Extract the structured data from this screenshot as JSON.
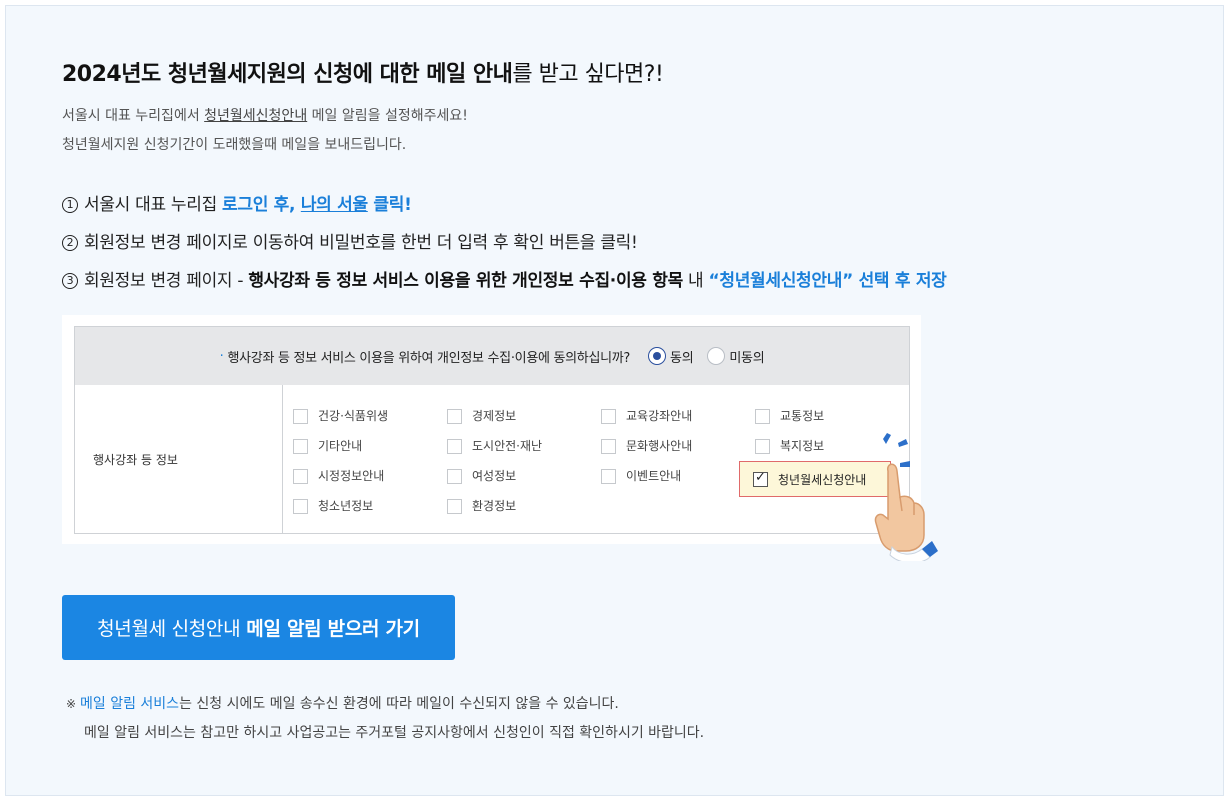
{
  "title": {
    "bold": "2024년도 청년월세지원의 신청에 대한 메일 안내",
    "light": "를 받고 싶다면?!"
  },
  "desc": {
    "line1_before": "서울시 대표 누리집에서 ",
    "line1_link": "청년월세신청안내",
    "line1_after": " 메일 알림을 설정해주세요!",
    "line2": "청년월세지원 신청기간이 도래했을때 메일을 보내드립니다."
  },
  "steps": [
    {
      "num": "1",
      "text": "서울시 대표 누리집 ",
      "blue1": "로그인 후, ",
      "blue_link": "나의 서울",
      "blue2": " 클릭!"
    },
    {
      "num": "2",
      "text": "회원정보 변경 페이지로 이동하여 비밀번호를 한번 더 입력 후 확인 버튼을 클릭!"
    },
    {
      "num": "3",
      "text": "회원정보 변경 페이지 - ",
      "bold": "행사강좌 등 정보 서비스 이용을 위한 개인정보 수집·이용 항목",
      "mid": " 내 ",
      "blue": "“청년월세신청안내” 선택 후 저장"
    }
  ],
  "illustration": {
    "question": "행사강좌 등 정보 서비스 이용을 위하여 개인정보 수집·이용에 동의하십니까?",
    "agree": "동의",
    "disagree": "미동의",
    "row_label": "행사강좌 등 정보",
    "items": [
      "건강·식품위생",
      "경제정보",
      "교육강좌안내",
      "교통정보",
      "기타안내",
      "도시안전·재난",
      "문화행사안내",
      "복지정보",
      "시정정보안내",
      "여성정보",
      "이벤트안내",
      "청소년정보",
      "환경정보"
    ],
    "highlighted_item": "청년월세신청안내"
  },
  "cta": {
    "light": "청년월세 신청안내",
    "bold": "메일 알림 받으러 가기"
  },
  "notes": {
    "mark": "※",
    "link": "메일 알림 서비스",
    "line1_rest": "는 신청 시에도 메일 송수신 환경에 따라 메일이 수신되지 않을 수 있습니다.",
    "line2": "메일 알림 서비스는 참고만 하시고 사업공고는 주거포털 공지사항에서 신청인이 직접 확인하시기 바랍니다."
  },
  "colors": {
    "accent": "#1b86e3",
    "panel_bg": "#f3f8fd",
    "highlight_bg": "#fdf7d9",
    "highlight_border": "#e06a6a"
  }
}
